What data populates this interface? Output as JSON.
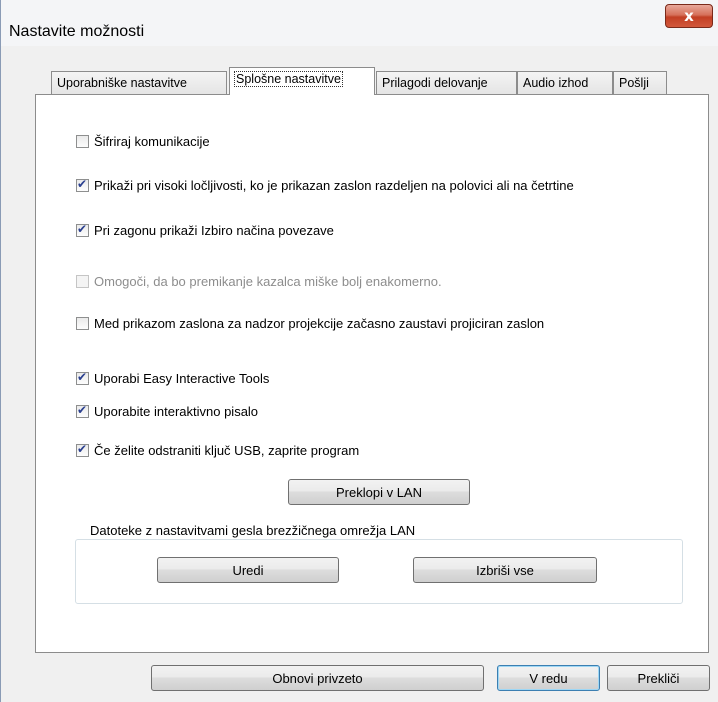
{
  "window": {
    "title": "Nastavite možnosti",
    "close_label": "x"
  },
  "tabs": [
    {
      "label": "Uporabniške nastavitve"
    },
    {
      "label": "Splošne nastavitve",
      "active": true
    },
    {
      "label": "Prilagodi delovanje"
    },
    {
      "label": "Audio izhod"
    },
    {
      "label": "Pošlji"
    }
  ],
  "options": [
    {
      "label": "Šifriraj komunikacije",
      "checked": false,
      "enabled": true
    },
    {
      "label": "Prikaži pri visoki ločljivosti, ko je prikazan zaslon razdeljen na polovici ali na četrtine",
      "checked": true,
      "enabled": true
    },
    {
      "label": "Pri zagonu prikaži Izbiro načina povezave",
      "checked": true,
      "enabled": true
    },
    {
      "label": "Omogoči, da bo premikanje kazalca miške bolj enakomerno.",
      "checked": false,
      "enabled": false
    },
    {
      "label": "Med prikazom zaslona za nadzor projekcije začasno zaustavi projiciran zaslon",
      "checked": false,
      "enabled": true
    },
    {
      "label": "Uporabi Easy Interactive Tools",
      "checked": true,
      "enabled": true
    },
    {
      "label": "Uporabite interaktivno pisalo",
      "checked": true,
      "enabled": true
    },
    {
      "label": "Če želite odstraniti ključ USB, zaprite program",
      "checked": true,
      "enabled": true
    }
  ],
  "buttons": {
    "switch_lan": "Preklopi v LAN",
    "edit": "Uredi",
    "delete_all": "Izbriši vse",
    "restore_defaults": "Obnovi privzeto",
    "ok": "V redu",
    "cancel": "Prekliči"
  },
  "wireless_group": {
    "title": "Datoteke z nastavitvami gesla brezžičnega omrežja LAN"
  }
}
